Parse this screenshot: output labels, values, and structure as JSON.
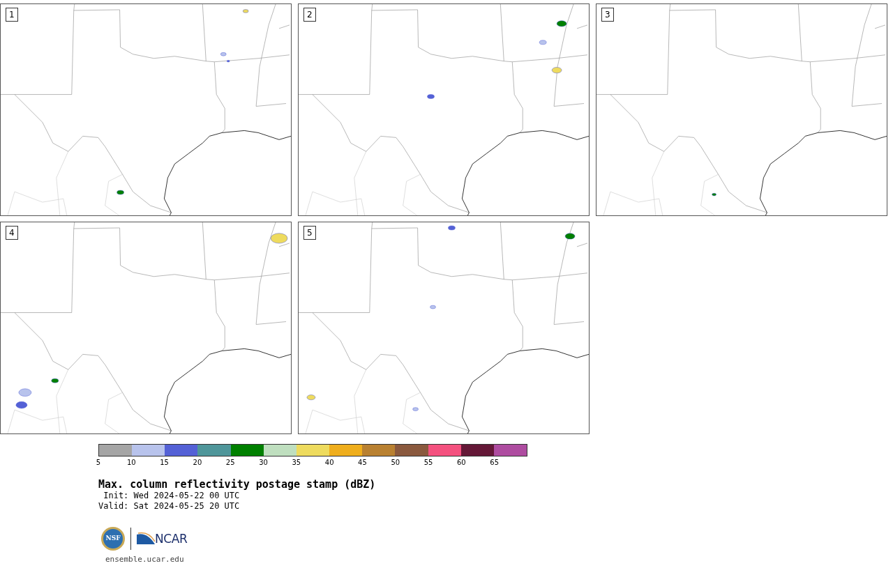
{
  "panels": [
    {
      "label": "1"
    },
    {
      "label": "2"
    },
    {
      "label": "3"
    },
    {
      "label": "4"
    },
    {
      "label": "5"
    }
  ],
  "colorbar": {
    "segments": [
      {
        "color": "#a5a5a5"
      },
      {
        "color": "#b8c3ec"
      },
      {
        "color": "#5461d6"
      },
      {
        "color": "#4f969a"
      },
      {
        "color": "#008000"
      },
      {
        "color": "#bfdfbf"
      },
      {
        "color": "#eedb5e"
      },
      {
        "color": "#efae1d"
      },
      {
        "color": "#b98131"
      },
      {
        "color": "#8a593e"
      },
      {
        "color": "#f4517f"
      },
      {
        "color": "#641837"
      },
      {
        "color": "#ae4ca0"
      }
    ],
    "ticks": [
      "5",
      "10",
      "15",
      "20",
      "25",
      "30",
      "35",
      "40",
      "45",
      "50",
      "55",
      "60",
      "65"
    ]
  },
  "title": "Max. column reflectivity postage stamp (dBZ)",
  "init": " Init: Wed 2024-05-22 00 UTC",
  "valid": "Valid: Sat 2024-05-25 20 UTC",
  "logos": {
    "seal": "NSF",
    "wordmark": "NCAR"
  },
  "footer": "ensemble.ucar.edu"
}
